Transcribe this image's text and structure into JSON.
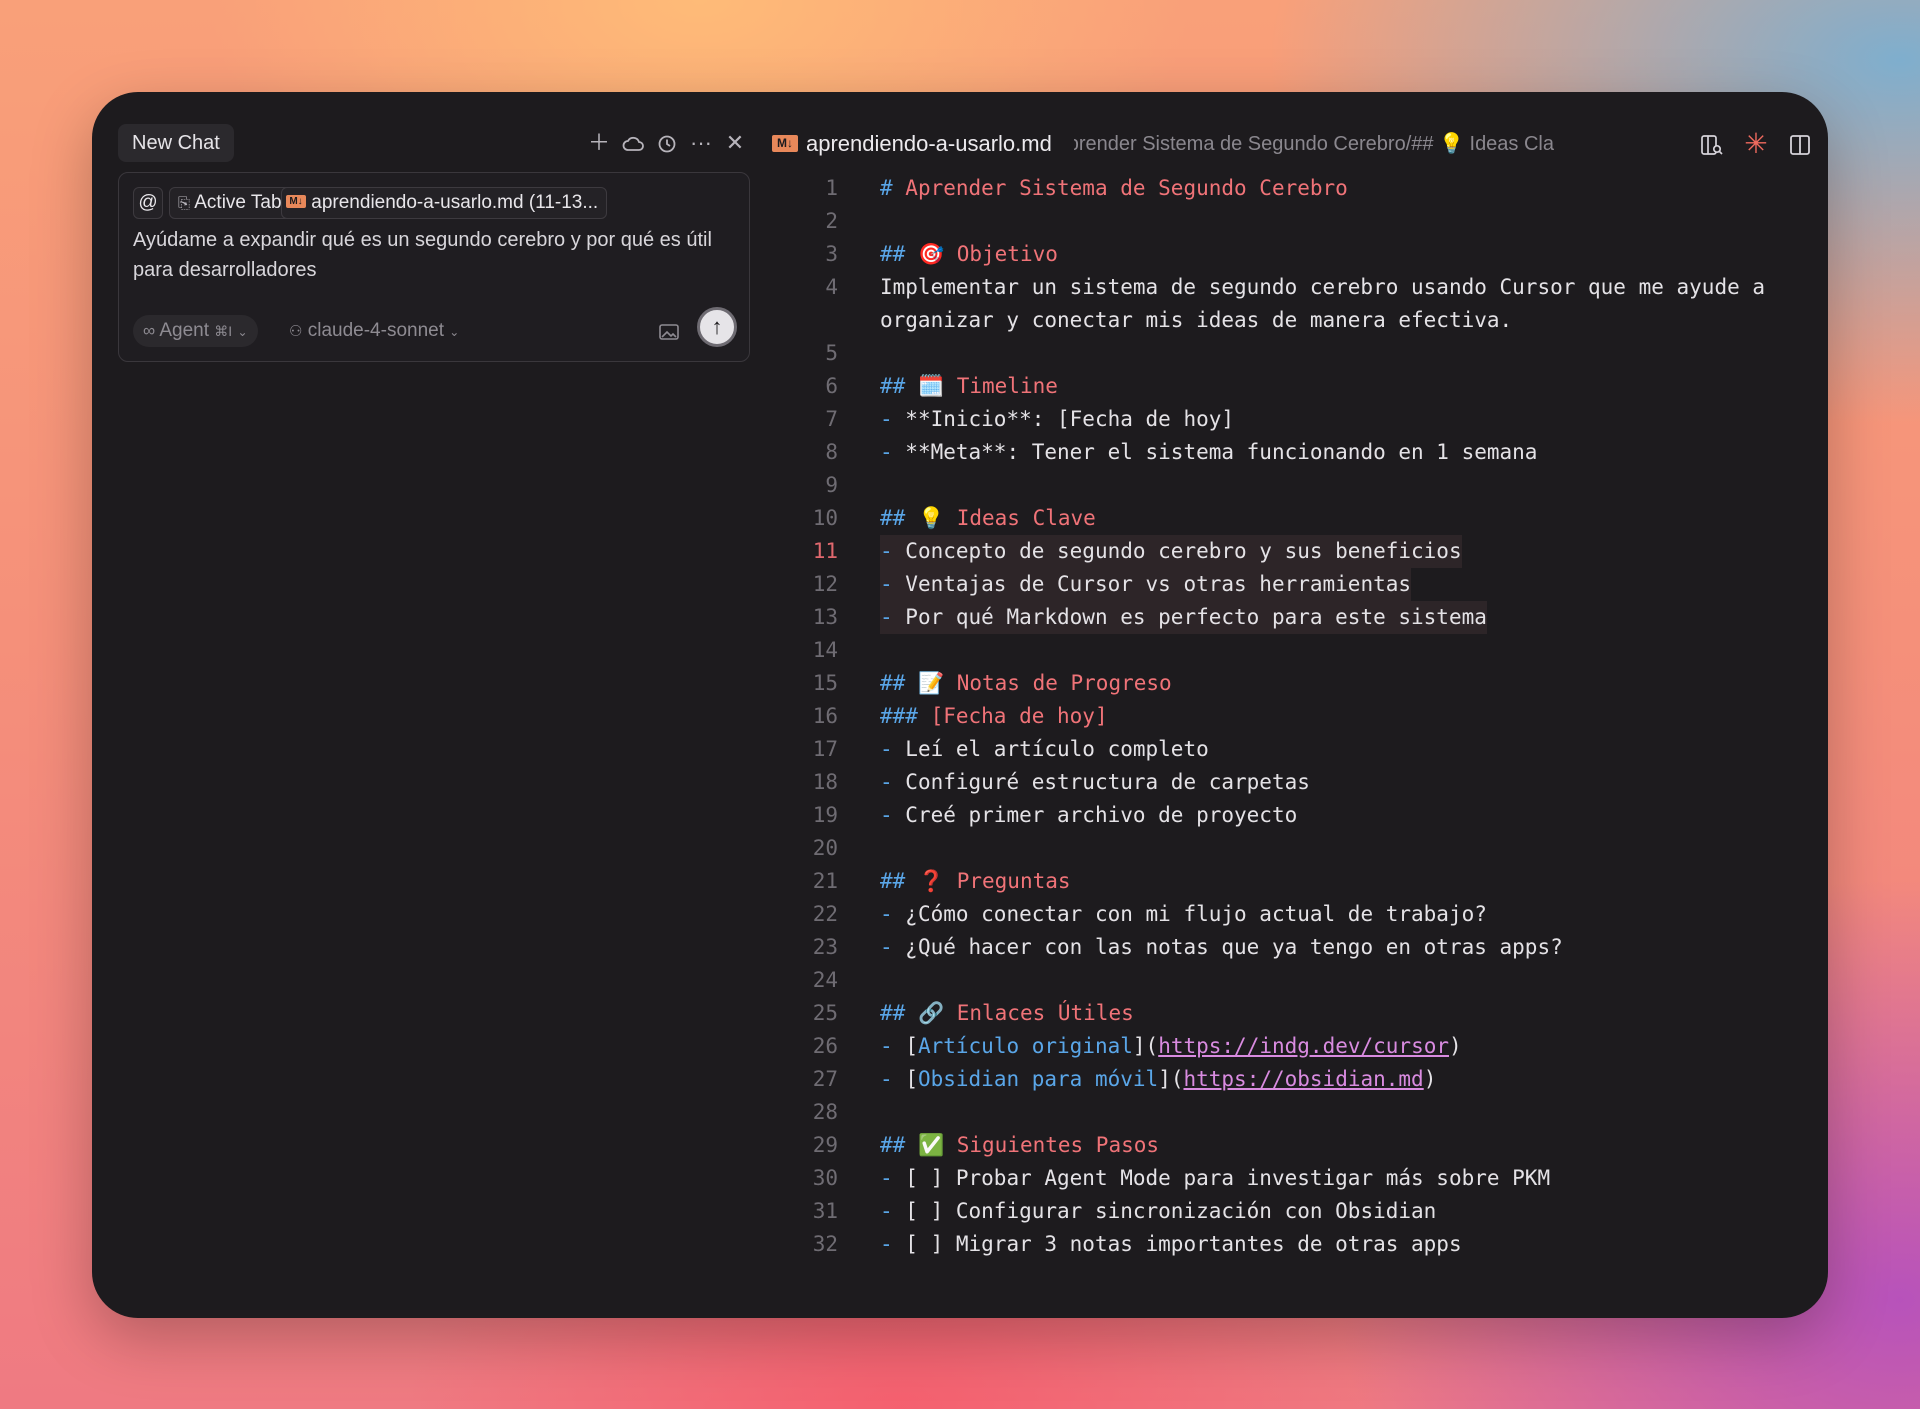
{
  "chat": {
    "tab_label": "New Chat",
    "header_icons": [
      "plus-icon",
      "cloud-icon",
      "history-icon",
      "more-icon",
      "close-icon"
    ],
    "context_chips": {
      "mention_symbol": "@",
      "active_tab_label": "Active Tab",
      "file_badge": "M↓",
      "file_label": "aprendiendo-a-usarlo.md (11-13..."
    },
    "prompt_text": "Ayúdame a expandir qué es un segundo cerebro y por qué es útil para desarrolladores",
    "mode": {
      "label": "Agent",
      "shortcut": "⌘I"
    },
    "model": "claude-4-sonnet"
  },
  "editor": {
    "file_badge": "M↓",
    "file_name": "aprendiendo-a-usarlo.md",
    "breadcrumb": "Aprender Sistema de Segundo Cerebro/## 💡 Ideas Cla",
    "active_line": 11,
    "highlighted_lines": [
      11,
      12,
      13
    ],
    "lines": [
      {
        "n": "1",
        "t": "# Aprender Sistema de Segundo Cerebro"
      },
      {
        "n": "2",
        "t": ""
      },
      {
        "n": "3",
        "t": "## 🎯 Objetivo"
      },
      {
        "n": "4",
        "t": "Implementar un sistema de segundo cerebro usando Cursor que me ayude a"
      },
      {
        "n": "",
        "t": "organizar y conectar mis ideas de manera efectiva."
      },
      {
        "n": "5",
        "t": ""
      },
      {
        "n": "6",
        "t": "## 🗓️ Timeline"
      },
      {
        "n": "7",
        "t": "- **Inicio**: [Fecha de hoy]"
      },
      {
        "n": "8",
        "t": "- **Meta**: Tener el sistema funcionando en 1 semana"
      },
      {
        "n": "9",
        "t": ""
      },
      {
        "n": "10",
        "t": "## 💡 Ideas Clave"
      },
      {
        "n": "11",
        "t": "- Concepto de segundo cerebro y sus beneficios"
      },
      {
        "n": "12",
        "t": "- Ventajas de Cursor vs otras herramientas"
      },
      {
        "n": "13",
        "t": "- Por qué Markdown es perfecto para este sistema"
      },
      {
        "n": "14",
        "t": ""
      },
      {
        "n": "15",
        "t": "## 📝 Notas de Progreso"
      },
      {
        "n": "16",
        "t": "### [Fecha de hoy]"
      },
      {
        "n": "17",
        "t": "- Leí el artículo completo"
      },
      {
        "n": "18",
        "t": "- Configuré estructura de carpetas"
      },
      {
        "n": "19",
        "t": "- Creé primer archivo de proyecto"
      },
      {
        "n": "20",
        "t": ""
      },
      {
        "n": "21",
        "t": "## ❓ Preguntas"
      },
      {
        "n": "22",
        "t": "- ¿Cómo conectar con mi flujo actual de trabajo?"
      },
      {
        "n": "23",
        "t": "- ¿Qué hacer con las notas que ya tengo en otras apps?"
      },
      {
        "n": "24",
        "t": ""
      },
      {
        "n": "25",
        "t": "## 🔗 Enlaces Útiles"
      },
      {
        "n": "26",
        "t": "- [Artículo original](https://indg.dev/cursor)"
      },
      {
        "n": "27",
        "t": "- [Obsidian para móvil](https://obsidian.md)"
      },
      {
        "n": "28",
        "t": ""
      },
      {
        "n": "29",
        "t": "## ✅ Siguientes Pasos"
      },
      {
        "n": "30",
        "t": "- [ ] Probar Agent Mode para investigar más sobre PKM"
      },
      {
        "n": "31",
        "t": "- [ ] Configurar sincronización con Obsidian"
      },
      {
        "n": "32",
        "t": "- [ ] Migrar 3 notas importantes de otras apps"
      }
    ]
  }
}
